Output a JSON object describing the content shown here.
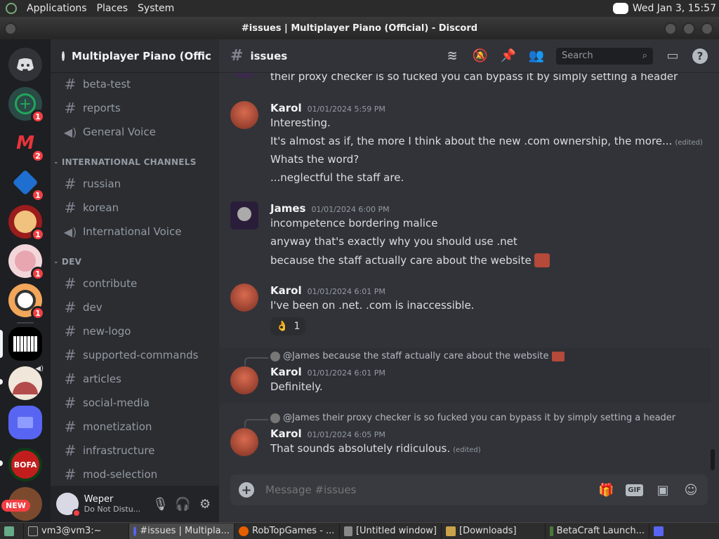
{
  "system_bar": {
    "menus": [
      "Applications",
      "Places",
      "System"
    ],
    "clock": "Wed Jan  3, 15:57"
  },
  "window": {
    "title": "#issues | Multiplayer Piano (Official) - Discord"
  },
  "guilds": {
    "badges": [
      "1",
      "2",
      "1",
      "1",
      "1",
      "1"
    ],
    "new_label": "NEW"
  },
  "server": {
    "name": "Multiplayer Piano (Offic"
  },
  "channels": {
    "top": [
      {
        "label": "beta-test",
        "type": "text"
      },
      {
        "label": "reports",
        "type": "text"
      },
      {
        "label": "General Voice",
        "type": "voice"
      }
    ],
    "cat_international": "INTERNATIONAL CHANNELS",
    "international": [
      {
        "label": "russian",
        "type": "text"
      },
      {
        "label": "korean",
        "type": "text"
      },
      {
        "label": "International Voice",
        "type": "voice"
      }
    ],
    "cat_dev": "DEV",
    "dev": [
      {
        "label": "contribute",
        "type": "text"
      },
      {
        "label": "dev",
        "type": "text"
      },
      {
        "label": "new-logo",
        "type": "text"
      },
      {
        "label": "supported-commands",
        "type": "text"
      },
      {
        "label": "articles",
        "type": "text"
      },
      {
        "label": "social-media",
        "type": "text"
      },
      {
        "label": "monetization",
        "type": "text"
      },
      {
        "label": "infrastructure",
        "type": "text"
      },
      {
        "label": "mod-selection",
        "type": "text"
      }
    ]
  },
  "user": {
    "name": "Weper",
    "status": "Do Not Distu..."
  },
  "header": {
    "channel": "issues",
    "search_placeholder": "Search"
  },
  "messages": {
    "top_fragment": "their proxy checker is so fucked you can bypass it by simply setting a header",
    "m1": {
      "author": "Karol",
      "time": "01/01/2024 5:59 PM",
      "l1": "Interesting.",
      "l2": "It's almost as if, the more I think about the new .com ownership, the more...",
      "l2_edited": "(edited)",
      "l3": "Whats the word?",
      "l4": "...neglectful the staff are."
    },
    "m2": {
      "author": "James",
      "time": "01/01/2024 6:00 PM",
      "l1": "incompetence bordering malice",
      "l2": "anyway that's exactly why you should use .net",
      "l3": "because the staff actually care about the website"
    },
    "m3": {
      "author": "Karol",
      "time": "01/01/2024 6:01 PM",
      "l1": "I've been on .net. .com is inaccessible.",
      "reaction_emoji": "👌",
      "reaction_count": "1"
    },
    "m4": {
      "reply": "@James because the staff actually care about the website",
      "author": "Karol",
      "time": "01/01/2024 6:01 PM",
      "l1": "Definitely."
    },
    "m5": {
      "reply": "@James their proxy checker is so fucked you can bypass it by simply setting a header",
      "author": "Karol",
      "time": "01/01/2024 6:05 PM",
      "l1": "That sounds absolutely ridiculous.",
      "l1_edited": "(edited)"
    }
  },
  "composer": {
    "placeholder": "Message #issues",
    "gif_label": "GIF"
  },
  "taskbar": {
    "items": [
      "vm3@vm3:~",
      "#issues | Multipla...",
      "RobTopGames - ...",
      "[Untitled window]",
      "[Downloads]",
      "BetaCraft Launch..."
    ]
  }
}
